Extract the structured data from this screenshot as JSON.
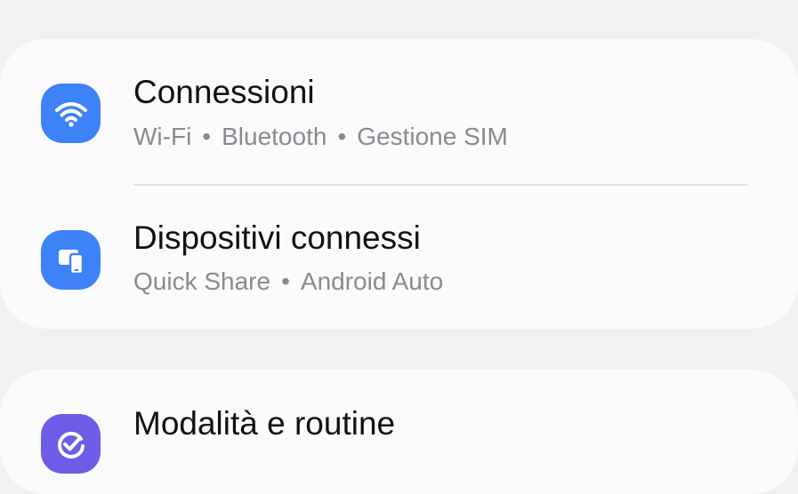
{
  "groups": [
    {
      "items": [
        {
          "title": "Connessioni",
          "subtitle_parts": [
            "Wi-Fi",
            "Bluetooth",
            "Gestione SIM"
          ],
          "icon": "wifi-icon",
          "icon_color": "#3e82f7"
        },
        {
          "title": "Dispositivi connessi",
          "subtitle_parts": [
            "Quick Share",
            "Android Auto"
          ],
          "icon": "connected-devices-icon",
          "icon_color": "#3e82f7"
        }
      ]
    },
    {
      "items": [
        {
          "title": "Modalità e routine",
          "icon": "modes-routines-icon",
          "icon_color": "#6d5ce7"
        }
      ]
    }
  ],
  "separator": "•"
}
